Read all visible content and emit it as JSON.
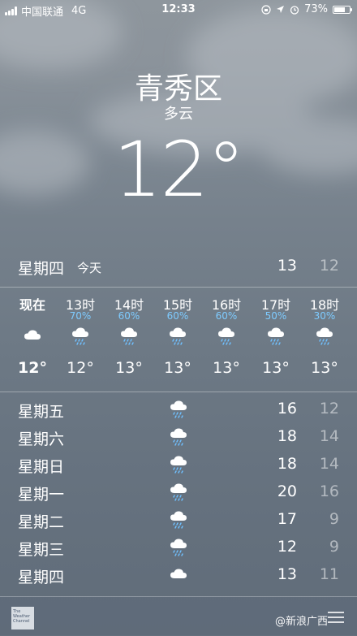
{
  "status": {
    "carrier": "中国联通",
    "network": "4G",
    "time": "12:33",
    "battery": "73%",
    "battery_level": 0.73
  },
  "location": {
    "city": "青秀区",
    "condition": "多云",
    "temperature": "12°"
  },
  "today": {
    "day": "星期四",
    "label": "今天",
    "high": "13",
    "low": "12"
  },
  "hourly": [
    {
      "label": "现在",
      "precip": "",
      "icon": "cloud-icon",
      "temp": "12°"
    },
    {
      "label": "13时",
      "precip": "70%",
      "icon": "rain-icon",
      "temp": "12°"
    },
    {
      "label": "14时",
      "precip": "60%",
      "icon": "rain-icon",
      "temp": "13°"
    },
    {
      "label": "15时",
      "precip": "60%",
      "icon": "rain-icon",
      "temp": "13°"
    },
    {
      "label": "16时",
      "precip": "60%",
      "icon": "rain-icon",
      "temp": "13°"
    },
    {
      "label": "17时",
      "precip": "50%",
      "icon": "rain-icon",
      "temp": "13°"
    },
    {
      "label": "18时",
      "precip": "30%",
      "icon": "rain-icon",
      "temp": "13°"
    }
  ],
  "daily": [
    {
      "day": "星期五",
      "icon": "rain-icon",
      "high": "16",
      "low": "12"
    },
    {
      "day": "星期六",
      "icon": "rain-icon",
      "high": "18",
      "low": "14"
    },
    {
      "day": "星期日",
      "icon": "rain-icon",
      "high": "18",
      "low": "14"
    },
    {
      "day": "星期一",
      "icon": "rain-icon",
      "high": "20",
      "low": "16"
    },
    {
      "day": "星期二",
      "icon": "rain-icon",
      "high": "17",
      "low": "9"
    },
    {
      "day": "星期三",
      "icon": "rain-icon",
      "high": "12",
      "low": "9"
    },
    {
      "day": "星期四",
      "icon": "cloud-icon",
      "high": "13",
      "low": "11"
    }
  ],
  "footer": {
    "provider_logo_text": "The Weather Channel",
    "watermark": "@新浪广西",
    "list_icon": "list-icon"
  }
}
